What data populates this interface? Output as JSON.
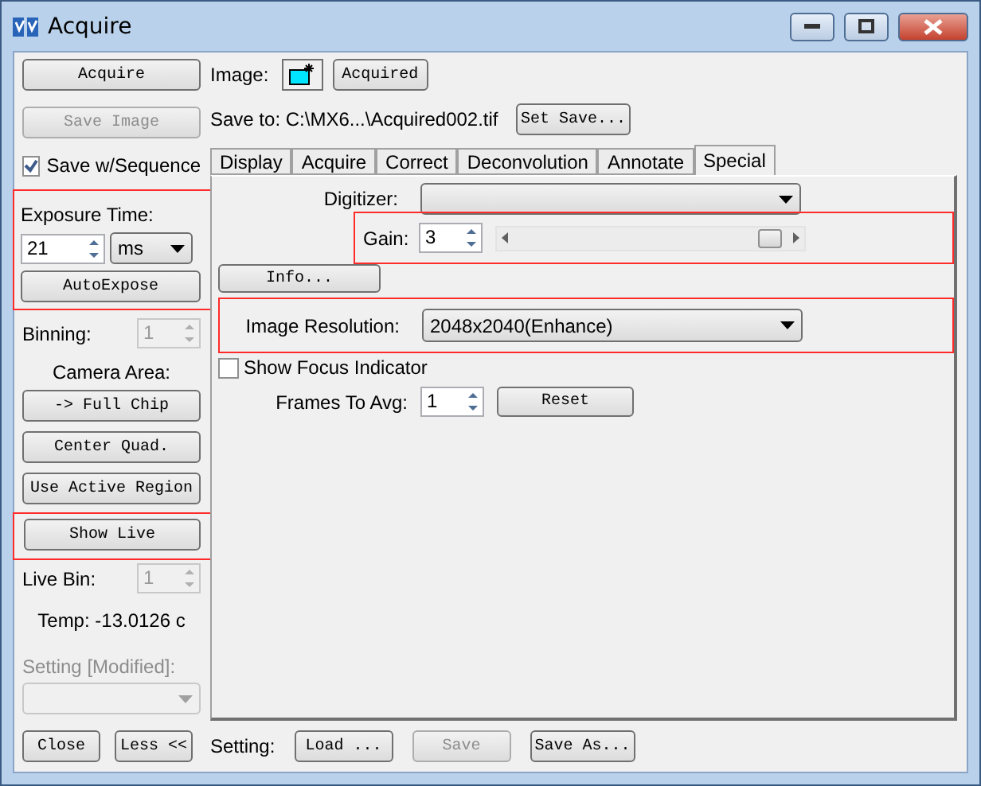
{
  "window": {
    "title": "Acquire"
  },
  "left": {
    "acquire_button": {
      "label": "Acquire",
      "disabled": false
    },
    "save_image_button": {
      "label": "Save Image",
      "disabled": true
    },
    "save_sequence": {
      "label": "Save w/Sequence",
      "checked": true
    },
    "exposure": {
      "highlighted": true,
      "label": "Exposure Time:",
      "value": "21",
      "unit": "ms",
      "button": "AutoExpose"
    },
    "binning": {
      "label": "Binning:",
      "value": "1",
      "disabled": true
    },
    "camera_area": {
      "label": "Camera Area:",
      "buttons": [
        "-> Full Chip",
        "Center Quad.",
        "Use Active Region"
      ]
    },
    "show_live": {
      "highlighted": true,
      "label": "Show Live"
    },
    "live_bin": {
      "label": "Live Bin:",
      "value": "1",
      "disabled": true
    },
    "temperature": "Temp: -13.0126 c",
    "setting": {
      "label": "Setting [Modified]:",
      "disabled": true
    },
    "close_button": "Close",
    "less_button": "Less <<"
  },
  "image": {
    "label": "Image:",
    "button": "Acquired",
    "save_to": "Save to: C:\\MX6...\\Acquired002.tif",
    "set_save_button": "Set Save..."
  },
  "tabs": [
    {
      "label": "Display",
      "selected": false
    },
    {
      "label": "Acquire",
      "selected": false
    },
    {
      "label": "Correct",
      "selected": false
    },
    {
      "label": "Deconvolution",
      "selected": false
    },
    {
      "label": "Annotate",
      "selected": false
    },
    {
      "label": "Special",
      "selected": true
    }
  ],
  "special": {
    "digitizer": {
      "label": "Digitizer:"
    },
    "gain": {
      "highlighted": true,
      "label": "Gain:",
      "value": "3",
      "level": 0.93
    },
    "info_button": "Info...",
    "resolution": {
      "highlighted": true,
      "label": "Image Resolution:",
      "value": "2048x2040(Enhance)"
    },
    "focus_indicator": {
      "label": "Show Focus Indicator",
      "checked": false
    },
    "frames": {
      "label": "Frames To Avg:",
      "value": "1",
      "button": "Reset"
    }
  },
  "footer": {
    "label": "Setting:",
    "buttons": [
      {
        "label": "Load ...",
        "disabled": false
      },
      {
        "label": "Save",
        "disabled": true
      },
      {
        "label": "Save As...",
        "disabled": false
      }
    ]
  }
}
